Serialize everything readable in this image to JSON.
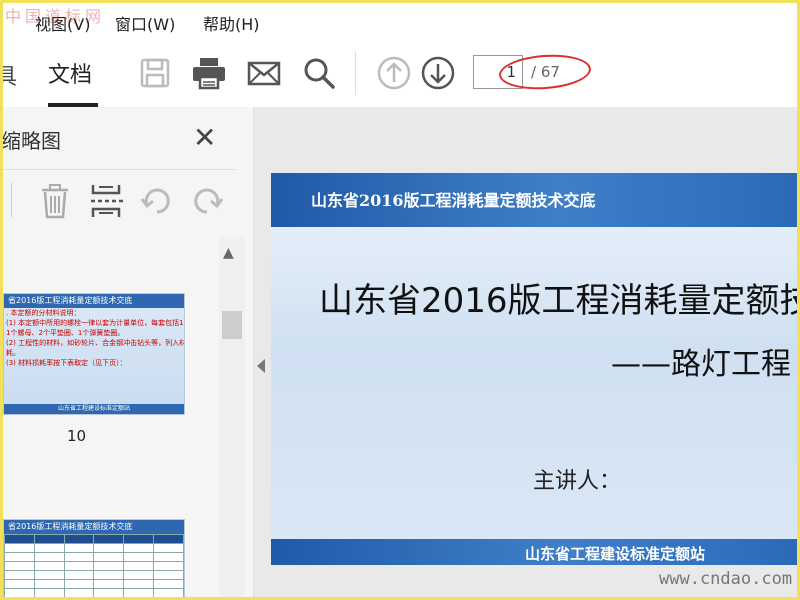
{
  "watermark_top": "中国道标网",
  "watermark_bottom": "www.cndao.com",
  "menu": [
    "视图(V)",
    "窗口(W)",
    "帮助(H)"
  ],
  "toolbar": {
    "partial_tab": "具",
    "doc_tab": "文档",
    "icons": [
      "save-icon",
      "print-icon",
      "email-icon",
      "search-icon",
      "prev-page-icon",
      "next-page-icon"
    ],
    "page_current": "1",
    "page_total": "/ 67"
  },
  "panel": {
    "title": "缩略图",
    "thumb1": {
      "header": "省2016版工程消耗量定额技术交底",
      "lines": [
        ". 本定额的分材料说明：",
        "(1) 本定额中所用的螺栓一律以套为计量单位，每套包括1个",
        "1个螺母、2个平垫圈、1个弹簧垫圈。",
        "(2) 工程性的材料，如砂轮片、合金钢冲击钻头等，列入材料消",
        "耗。",
        "(3) 材料损耗率按下表取定（见下页）："
      ],
      "footer": "山东省工程建设标准定额站",
      "label": "10"
    },
    "thumb2": {
      "header": "省2016版工程消耗量定额技术交底"
    }
  },
  "slide": {
    "header": "山东省2016版工程消耗量定额技术交底",
    "title": "山东省2016版工程消耗量定额技",
    "subtitle": "——路灯工程",
    "speaker": "主讲人：",
    "footer": "山东省工程建设标准定额站"
  },
  "colors": {
    "slide_blue": "#2f68b0",
    "annotation_red": "#d83030"
  }
}
